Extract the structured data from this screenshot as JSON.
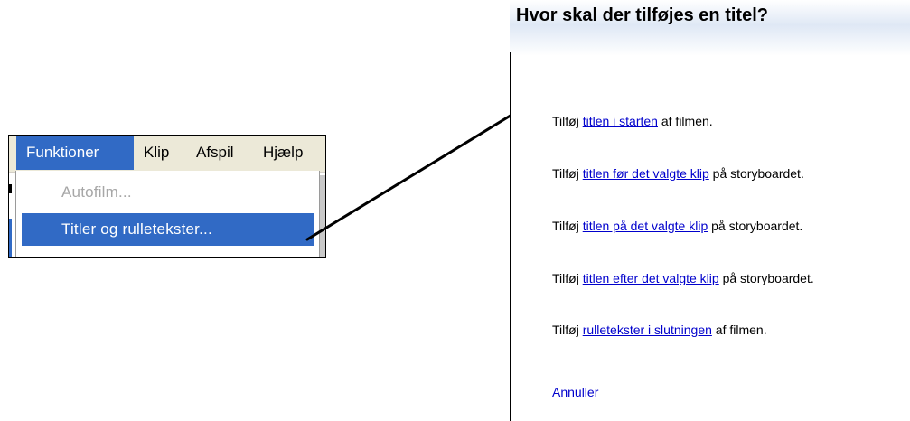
{
  "menu": {
    "menubar": [
      "Funktioner",
      "Klip",
      "Afspil",
      "Hjælp"
    ],
    "dropdown": {
      "items": [
        {
          "label": "Autofilm...",
          "state": "disabled"
        },
        {
          "label": "Titler og rulletekster...",
          "state": "selected"
        }
      ]
    }
  },
  "pane": {
    "title": "Hvor skal der tilføjes en titel?",
    "options": [
      {
        "prefix": "Tilføj ",
        "link": "titlen i starten",
        "suffix": " af filmen."
      },
      {
        "prefix": "Tilføj ",
        "link": "titlen før det valgte klip",
        "suffix": " på storyboardet."
      },
      {
        "prefix": "Tilføj ",
        "link": "titlen på det valgte klip",
        "suffix": " på storyboardet."
      },
      {
        "prefix": "Tilføj ",
        "link": "titlen efter det valgte klip",
        "suffix": " på storyboardet."
      },
      {
        "prefix": "Tilføj ",
        "link": "rulletekster i slutningen",
        "suffix": " af filmen."
      }
    ],
    "cancel": "Annuller"
  },
  "colors": {
    "highlight": "#316ac5",
    "link": "#0000cc",
    "disabled_text": "#a7a7a7",
    "menubar_bg": "#ece9d8"
  }
}
